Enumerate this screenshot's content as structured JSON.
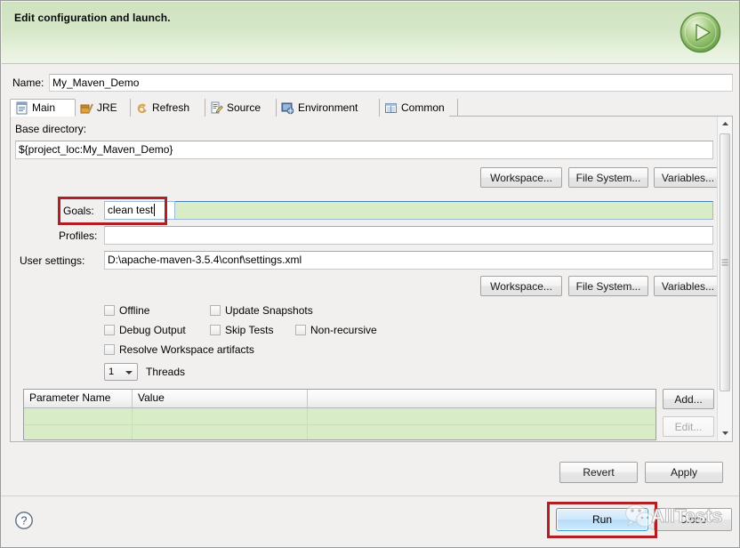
{
  "banner": {
    "title": "Edit configuration and launch.",
    "icon": "run-play-icon"
  },
  "name_row": {
    "label": "Name:",
    "value": "My_Maven_Demo"
  },
  "tabs": [
    {
      "label": "Main",
      "icon": "main-tab-icon",
      "selected": true
    },
    {
      "label": "JRE",
      "icon": "jre-tab-icon",
      "selected": false
    },
    {
      "label": "Refresh",
      "icon": "refresh-tab-icon",
      "selected": false
    },
    {
      "label": "Source",
      "icon": "source-tab-icon",
      "selected": false
    },
    {
      "label": "Environment",
      "icon": "environment-tab-icon",
      "selected": false
    },
    {
      "label": "Common",
      "icon": "common-tab-icon",
      "selected": false
    }
  ],
  "main": {
    "base_directory_label": "Base directory:",
    "base_directory_value": "${project_loc:My_Maven_Demo}",
    "base_buttons": [
      "Workspace...",
      "File System...",
      "Variables..."
    ],
    "goals_label": "Goals:",
    "goals_value": "clean test",
    "profiles_label": "Profiles:",
    "profiles_value": "",
    "user_settings_label": "User settings:",
    "user_settings_value": "D:\\apache-maven-3.5.4\\conf\\settings.xml",
    "settings_buttons": [
      "Workspace...",
      "File System...",
      "Variables..."
    ],
    "checkboxes": [
      {
        "label": "Offline",
        "checked": false
      },
      {
        "label": "Update Snapshots",
        "checked": false
      },
      {
        "label": "Debug Output",
        "checked": false
      },
      {
        "label": "Skip Tests",
        "checked": false
      },
      {
        "label": "Non-recursive",
        "checked": false
      },
      {
        "label": "Resolve Workspace artifacts",
        "checked": false
      }
    ],
    "threads_value": "1",
    "threads_label": "Threads",
    "table": {
      "columns": [
        "Parameter Name",
        "Value",
        ""
      ],
      "rows": [
        [
          "",
          "",
          ""
        ],
        [
          "",
          "",
          ""
        ]
      ]
    },
    "table_buttons": [
      {
        "label": "Add...",
        "enabled": true
      },
      {
        "label": "Edit...",
        "enabled": false
      }
    ]
  },
  "footer": {
    "revert_label": "Revert",
    "apply_label": "Apply",
    "run_label": "Run",
    "close_label": "Close",
    "help_icon": "help-question-icon"
  },
  "watermark": {
    "text": "AllTests",
    "icon": "wechat-logo-icon"
  },
  "colors": {
    "banner_green": "#d5e7c7",
    "highlight_red": "#b01f24",
    "field_green": "#d9ecc8",
    "run_blue": "#3c97d3"
  }
}
